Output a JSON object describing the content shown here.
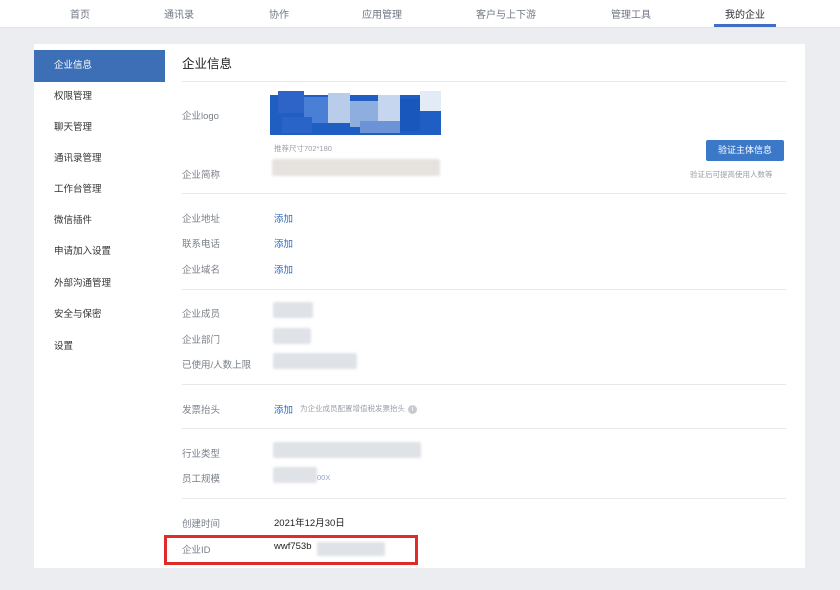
{
  "nav": {
    "tabs": [
      "首页",
      "通讯录",
      "协作",
      "应用管理",
      "客户与上下游",
      "管理工具",
      "我的企业"
    ],
    "active": "我的企业"
  },
  "sidebar": {
    "items": [
      "企业信息",
      "权限管理",
      "聊天管理",
      "通讯录管理",
      "工作台管理",
      "微信插件",
      "申请加入设置",
      "外部沟通管理",
      "安全与保密",
      "设置"
    ]
  },
  "main": {
    "title": "企业信息",
    "logo": {
      "label": "企业logo",
      "size_hint": "推荐尺寸702*180"
    },
    "name": {
      "label": "企业简称"
    },
    "verify": {
      "button": "验证主体信息",
      "hint": "验证后可提高使用人数等"
    },
    "address": {
      "label": "企业地址",
      "action": "添加"
    },
    "phone": {
      "label": "联系电话",
      "action": "添加"
    },
    "domain": {
      "label": "企业域名",
      "action": "添加"
    },
    "members": {
      "label": "企业成员"
    },
    "departments": {
      "label": "企业部门"
    },
    "limit": {
      "label": "已使用/人数上限"
    },
    "invoice": {
      "label": "发票抬头",
      "action": "添加",
      "hint": "为企业成员配置增值税发票抬头"
    },
    "industry": {
      "label": "行业类型"
    },
    "staff": {
      "label": "员工规模",
      "value_partial": "00X"
    },
    "created": {
      "label": "创建时间",
      "value": "2021年12月30日"
    },
    "corp_id": {
      "label": "企业ID",
      "value": "wwf753b"
    }
  },
  "colors": {
    "accent": "#3d6fb6",
    "link": "#2f69c4",
    "highlight": "#e02b2b"
  }
}
